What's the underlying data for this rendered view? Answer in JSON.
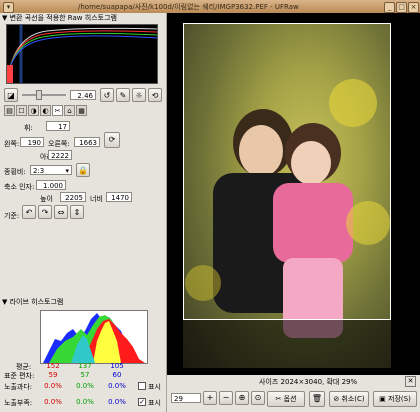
{
  "window": {
    "title": "/home/suapapa/사진/k100d/이림없는 쉐리/IMGP3632.PEF - UFRaw"
  },
  "sections": {
    "raw_histogram": "변환 곡선을 적용한 Raw 히스토그램",
    "live_histogram": "라이브 히스토그램"
  },
  "exposure": {
    "value": "2.46"
  },
  "white_balance": {
    "label1": "휘:",
    "value1": "17"
  },
  "crop": {
    "left_label": "왼쪽:",
    "left_value": "190",
    "right_label": "오른쪽:",
    "right_value": "1663",
    "bottom_label": "아래:",
    "bottom_value": "2222"
  },
  "aspect": {
    "label": "종횡비:",
    "value": "2:3"
  },
  "shrink": {
    "label": "축소 인자:",
    "value": "1.000",
    "height_label": "높이",
    "height_value": "2205",
    "width_label": "너비",
    "width_value": "1470"
  },
  "rotate": {
    "label": "기준:"
  },
  "stats": {
    "avg_label": "평균:",
    "std_label": "표준 편차:",
    "over_label": "노출과다:",
    "under_label": "노출부족:",
    "avg": [
      "152",
      "137",
      "105"
    ],
    "std": [
      "59",
      "57",
      "60"
    ],
    "over": [
      "0.0%",
      "0.0%",
      "0.0%"
    ],
    "under": [
      "0.0%",
      "0.0%",
      "0.0%"
    ],
    "show1": "표시",
    "show2": "표시"
  },
  "status": {
    "text": "사이즈 2024×3040, 확대 29%"
  },
  "bottom": {
    "zoom": "29",
    "options_label": "옵션",
    "cancel_label": "취소(C)",
    "save_label": "저장(S)"
  },
  "colors": {
    "accent": "#b98a55",
    "red": "#d00000",
    "green": "#00a000",
    "blue": "#0000d0"
  }
}
